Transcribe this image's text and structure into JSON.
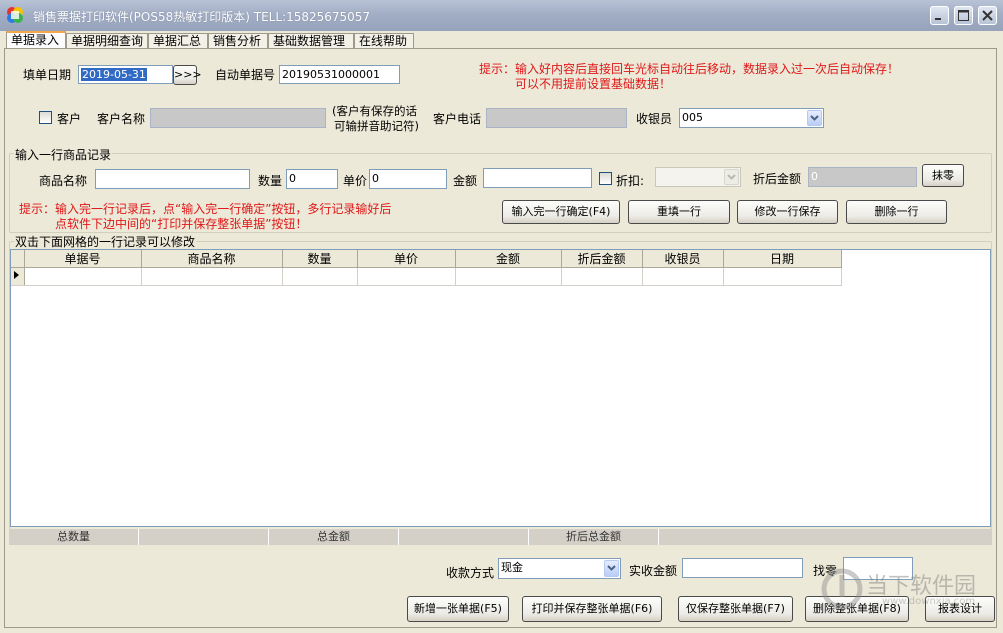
{
  "window": {
    "title": "销售票据打印软件(POS58热敏打印版本) TELL:15825675057",
    "icons": [
      "app-icon",
      "minimize-icon",
      "maximize-icon",
      "close-icon"
    ]
  },
  "tabs": [
    {
      "label": "单据录入",
      "active": true
    },
    {
      "label": "单据明细查询"
    },
    {
      "label": "单据汇总"
    },
    {
      "label": "销售分析"
    },
    {
      "label": "基础数据管理"
    },
    {
      "label": "在线帮助"
    }
  ],
  "header": {
    "date_label": "填单日期",
    "date_value": "2019-05-31",
    "date_picker_label": ">>>",
    "auto_no_label": "自动单据号",
    "auto_no_value": "20190531000001",
    "hint_line1": "提示：输入好内容后直接回车光标自动往后移动，数据录入过一次后自动保存！",
    "hint_line2": "可以不用提前设置基础数据！",
    "customer_checkbox_label": "客户",
    "customer_name_label": "客户名称",
    "customer_note_line1": "(客户有保存的话",
    "customer_note_line2": "可输拼音助记符)",
    "customer_phone_label": "客户电话",
    "cashier_label": "收银员",
    "cashier_value": "005"
  },
  "item_group": {
    "title": "输入一行商品记录",
    "product_label": "商品名称",
    "qty_label": "数量",
    "qty_value": "0",
    "price_label": "单价",
    "price_value": "0",
    "amount_label": "金额",
    "discount_label": "折扣:",
    "discounted_label": "折后金额",
    "discounted_value": "0",
    "round_button": "抹零",
    "hint_line1": "提示：输入完一行记录后，点“输入完一行确定”按钮，多行记录输好后",
    "hint_line2": "点软件下边中间的“打印并保存整张单据”按钮！",
    "confirm_button": "输入完一行确定(F4)",
    "refill_button": "重填一行",
    "modify_button": "修改一行保存",
    "delete_button": "删除一行"
  },
  "grid": {
    "title": "双击下面网格的一行记录可以修改",
    "columns": [
      "单据号",
      "商品名称",
      "数量",
      "单价",
      "金额",
      "折后金额",
      "收银员",
      "日期"
    ]
  },
  "totals": {
    "total_qty": "总数量",
    "total_amount": "总金额",
    "total_discounted": "折后总金额"
  },
  "footer": {
    "payment_label": "收款方式",
    "payment_value": "现金",
    "received_label": "实收金额",
    "change_label": "找零",
    "new_button": "新增一张单据(F5)",
    "print_save_button": "打印并保存整张单据(F6)",
    "save_only_button": "仅保存整张单据(F7)",
    "delete_doc_button": "删除整张单据(F8)",
    "report_design_button": "报表设计"
  },
  "watermark": {
    "text": "当下软件园",
    "url": "www.downxia.com"
  },
  "colors": {
    "hint": "#E01818",
    "titlebar": "#A2AEC5",
    "background": "#ECE9D8"
  }
}
